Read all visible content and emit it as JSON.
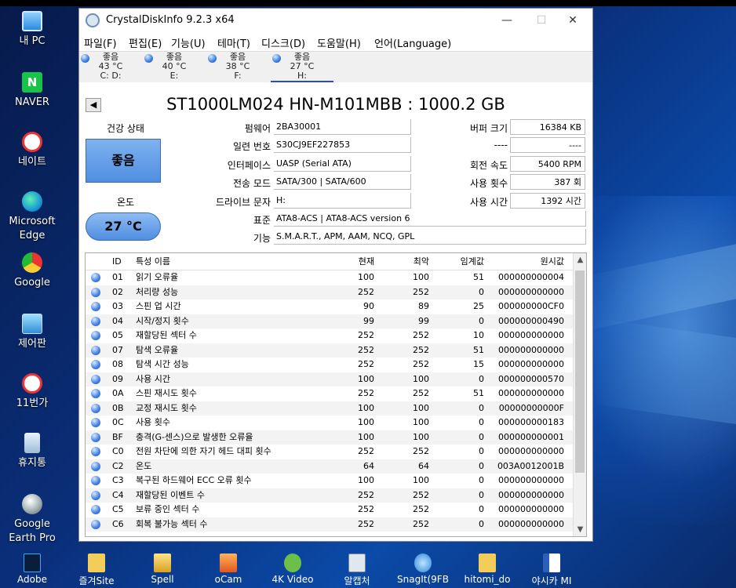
{
  "desktop": {
    "icons": [
      {
        "label": "내 PC",
        "icon": "computer-icon"
      },
      {
        "label": "NAVER",
        "icon": "naver-icon"
      },
      {
        "label": "네이트",
        "icon": "nate-icon"
      },
      {
        "label": "Microsoft Edge",
        "icon": "edge-icon"
      },
      {
        "label": "Google",
        "icon": "chrome-icon"
      },
      {
        "label": "제어판",
        "icon": "control-panel-icon"
      },
      {
        "label": "11번가",
        "icon": "shortcut-icon"
      },
      {
        "label": "휴지통",
        "icon": "recycle-bin-icon"
      },
      {
        "label": "Google Earth Pro",
        "icon": "google-earth-icon"
      }
    ],
    "taskbar_icons": [
      {
        "label": "Adobe",
        "icon": "photoshop-icon"
      },
      {
        "label": "즐겨Site",
        "icon": "folder-icon"
      },
      {
        "label": "Spell",
        "icon": "spell-icon"
      },
      {
        "label": "oCam",
        "icon": "ocam-icon"
      },
      {
        "label": "4K Video",
        "icon": "4k-video-icon"
      },
      {
        "label": "알캡처",
        "icon": "alcapture-icon"
      },
      {
        "label": "SnagIt(9FB",
        "icon": "snagit-icon"
      },
      {
        "label": "hitomi_do",
        "icon": "folder-icon"
      },
      {
        "label": "야시카 MI",
        "icon": "word-doc-icon"
      }
    ]
  },
  "window": {
    "title": "CrystalDiskInfo 9.2.3 x64",
    "controls": {
      "minimize": "—",
      "maximize": "☐",
      "close": "✕"
    },
    "menu": [
      "파일(F)",
      "편집(E)",
      "기능(U)",
      "테마(T)",
      "디스크(D)",
      "도움말(H)",
      "언어(Language)"
    ],
    "disks": [
      {
        "status": "좋음",
        "temp": "43 °C",
        "letters": "C: D:"
      },
      {
        "status": "좋음",
        "temp": "40 °C",
        "letters": "E:"
      },
      {
        "status": "좋음",
        "temp": "38 °C",
        "letters": "F:"
      },
      {
        "status": "좋음",
        "temp": "27 °C",
        "letters": "H:"
      }
    ],
    "model": "ST1000LM024 HN-M101MBB : 1000.2 GB",
    "health": {
      "label": "건강 상태",
      "value": "좋음"
    },
    "temperature": {
      "label": "온도",
      "value": "27 °C"
    },
    "fields": [
      {
        "label": "펌웨어",
        "value": "2BA30001"
      },
      {
        "label": "일련 번호",
        "value": "S30CJ9EF227853"
      },
      {
        "label": "인터페이스",
        "value": "UASP (Serial ATA)"
      },
      {
        "label": "전송 모드",
        "value": "SATA/300 | SATA/600"
      },
      {
        "label": "드라이브 문자",
        "value": "H:"
      }
    ],
    "standard": {
      "label": "표준",
      "value": "ATA8-ACS | ATA8-ACS version 6"
    },
    "features": {
      "label": "기능",
      "value": "S.M.A.R.T., APM, AAM, NCQ, GPL"
    },
    "right_fields": [
      {
        "label": "버퍼 크기",
        "value": "16384 KB"
      },
      {
        "label": "----",
        "value": "----"
      },
      {
        "label": "회전 속도",
        "value": "5400 RPM"
      },
      {
        "label": "사용 횟수",
        "value": "387 회"
      },
      {
        "label": "사용 시간",
        "value": "1392 시간"
      }
    ],
    "table": {
      "headers": [
        "ID",
        "특성 이름",
        "현재",
        "최악",
        "임계값",
        "원시값"
      ],
      "rows": [
        [
          "01",
          "읽기 오류율",
          "100",
          "100",
          "51",
          "000000000004"
        ],
        [
          "02",
          "처리량 성능",
          "252",
          "252",
          "0",
          "000000000000"
        ],
        [
          "03",
          "스핀 업 시간",
          "90",
          "89",
          "25",
          "000000000CF0"
        ],
        [
          "04",
          "시작/정지 횟수",
          "99",
          "99",
          "0",
          "000000000490"
        ],
        [
          "05",
          "재할당된 섹터 수",
          "252",
          "252",
          "10",
          "000000000000"
        ],
        [
          "07",
          "탐색 오류율",
          "252",
          "252",
          "51",
          "000000000000"
        ],
        [
          "08",
          "탐색 시간 성능",
          "252",
          "252",
          "15",
          "000000000000"
        ],
        [
          "09",
          "사용 시간",
          "100",
          "100",
          "0",
          "000000000570"
        ],
        [
          "0A",
          "스핀 재시도 횟수",
          "252",
          "252",
          "51",
          "000000000000"
        ],
        [
          "0B",
          "교정 재시도 횟수",
          "100",
          "100",
          "0",
          "00000000000F"
        ],
        [
          "0C",
          "사용 횟수",
          "100",
          "100",
          "0",
          "000000000183"
        ],
        [
          "BF",
          "충격(G-센스)으로 발생한 오류율",
          "100",
          "100",
          "0",
          "000000000001"
        ],
        [
          "C0",
          "전원 차단에 의한 자기 헤드 대피 횟수",
          "252",
          "252",
          "0",
          "000000000000"
        ],
        [
          "C2",
          "온도",
          "64",
          "64",
          "0",
          "003A0012001B"
        ],
        [
          "C3",
          "복구된 하드웨어 ECC 오류 횟수",
          "100",
          "100",
          "0",
          "000000000000"
        ],
        [
          "C4",
          "재할당된 이벤트 수",
          "252",
          "252",
          "0",
          "000000000000"
        ],
        [
          "C5",
          "보류 중인 섹터 수",
          "252",
          "252",
          "0",
          "000000000000"
        ],
        [
          "C6",
          "회복 불가능 섹터 수",
          "252",
          "252",
          "0",
          "000000000000"
        ]
      ]
    }
  }
}
